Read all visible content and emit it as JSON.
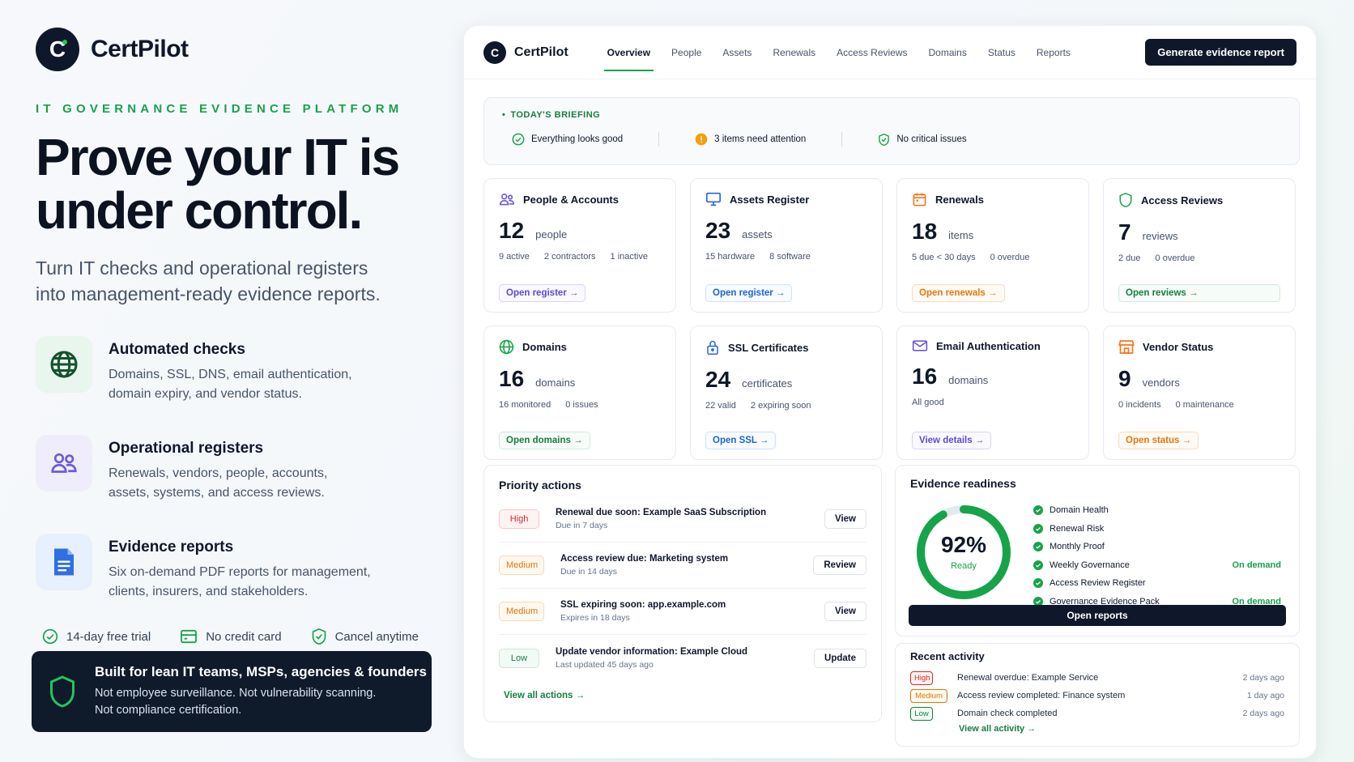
{
  "brand": {
    "name": "CertPilot",
    "logo_letter": "C"
  },
  "hero": {
    "eyebrow": "IT GOVERNANCE EVIDENCE PLATFORM",
    "headline_line1": "Prove your IT is",
    "headline_line2": "under control.",
    "subhead_line1": "Turn IT checks and operational registers",
    "subhead_line2": "into management-ready evidence reports."
  },
  "features": [
    {
      "icon": "globe-icon",
      "title": "Automated checks",
      "line1": "Domains, SSL, DNS, email authentication,",
      "line2": "domain expiry, and vendor status."
    },
    {
      "icon": "users-icon",
      "title": "Operational registers",
      "line1": "Renewals, vendors, people, accounts,",
      "line2": "assets, systems, and access reviews."
    },
    {
      "icon": "document-icon",
      "title": "Evidence reports",
      "line1": "Six on-demand PDF reports for management,",
      "line2": "clients, insurers, and stakeholders."
    }
  ],
  "perks": [
    "14-day free trial",
    "No credit card",
    "Cancel anytime"
  ],
  "callout": {
    "title": "Built for lean IT teams, MSPs, agencies & founders",
    "line1": "Not employee surveillance. Not vulnerability scanning.",
    "line2": "Not compliance certification."
  },
  "app": {
    "name": "CertPilot",
    "nav": [
      "Overview",
      "People",
      "Assets",
      "Renewals",
      "Access Reviews",
      "Domains",
      "Status",
      "Reports"
    ],
    "active_nav": "Overview",
    "generate_button": "Generate evidence report",
    "briefing": {
      "label": "TODAY'S BRIEFING",
      "items": [
        "Everything looks good",
        "3 items need attention",
        "No critical issues"
      ]
    },
    "cards": [
      {
        "title": "People & Accounts",
        "count": "12",
        "unit": "people",
        "subs": [
          "9 active",
          "2 contractors",
          "1 inactive"
        ],
        "button": "Open register →",
        "color": "#6d5bd8"
      },
      {
        "title": "Assets Register",
        "count": "23",
        "unit": "assets",
        "subs": [
          "15 hardware",
          "8 software"
        ],
        "button": "Open register →",
        "color": "#2563eb"
      },
      {
        "title": "Renewals",
        "count": "18",
        "unit": "items",
        "subs": [
          "5 due < 30 days",
          "0 overdue"
        ],
        "button": "Open renewals →",
        "color": "#f97316"
      },
      {
        "title": "Access Reviews",
        "count": "7",
        "unit": "reviews",
        "subs": [
          "2 due",
          "0 overdue"
        ],
        "button": "Open reviews →",
        "color": "#16a34a"
      },
      {
        "title": "Domains",
        "count": "16",
        "unit": "domains",
        "subs": [
          "16 monitored",
          "0 issues"
        ],
        "button": "Open domains →",
        "color": "#16a34a"
      },
      {
        "title": "SSL Certificates",
        "count": "24",
        "unit": "certificates",
        "subs": [
          "22 valid",
          "2 expiring soon"
        ],
        "button": "Open SSL →",
        "color": "#2563eb"
      },
      {
        "title": "Email Authentication",
        "count": "16",
        "unit": "domains",
        "subs": [
          "All good"
        ],
        "button": "View details →",
        "color": "#6d5bd8"
      },
      {
        "title": "Vendor Status",
        "count": "9",
        "unit": "vendors",
        "subs": [
          "0 incidents",
          "0 maintenance"
        ],
        "button": "Open status →",
        "color": "#f97316"
      }
    ],
    "priority": {
      "title": "Priority actions",
      "rows": [
        {
          "level": "High",
          "title": "Renewal due soon: Example SaaS Subscription",
          "sub": "Due in 7 days",
          "action": "View"
        },
        {
          "level": "Medium",
          "title": "Access review due: Marketing system",
          "sub": "Due in 14 days",
          "action": "Review"
        },
        {
          "level": "Medium",
          "title": "SSL expiring soon: app.example.com",
          "sub": "Expires in 18 days",
          "action": "View"
        },
        {
          "level": "Low",
          "title": "Update vendor information: Example Cloud",
          "sub": "Last updated 45 days ago",
          "action": "Update"
        }
      ],
      "view_all": "View all actions →"
    },
    "readiness": {
      "title": "Evidence readiness",
      "percent_label": "92%",
      "percent_value": 0.92,
      "status": "Ready",
      "items": [
        {
          "name": "Domain Health",
          "note": ""
        },
        {
          "name": "Renewal Risk",
          "note": ""
        },
        {
          "name": "Monthly Proof",
          "note": ""
        },
        {
          "name": "Weekly Governance",
          "note": "On demand"
        },
        {
          "name": "Access Review Register",
          "note": ""
        },
        {
          "name": "Governance Evidence Pack",
          "note": "On demand"
        }
      ],
      "button": "Open reports"
    },
    "activity": {
      "title": "Recent activity",
      "rows": [
        {
          "level": "High",
          "text": "Renewal overdue: Example Service",
          "when": "2 days ago"
        },
        {
          "level": "Medium",
          "text": "Access review completed: Finance system",
          "when": "1 day ago"
        },
        {
          "level": "Low",
          "text": "Domain check completed",
          "when": "2 days ago"
        }
      ],
      "view_all": "View all activity →"
    }
  }
}
